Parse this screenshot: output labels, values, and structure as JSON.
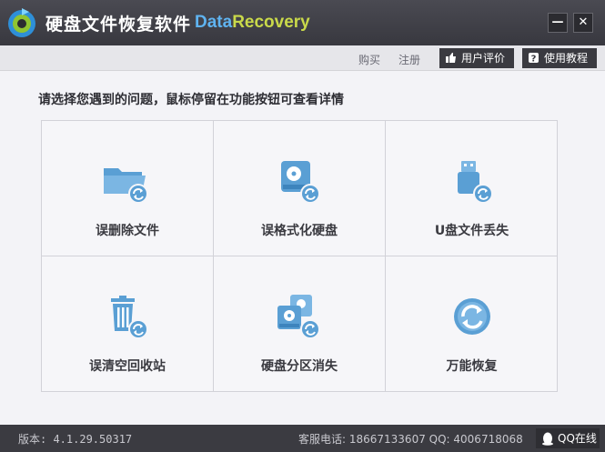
{
  "titlebar": {
    "app_title": "硬盘文件恢复软件",
    "brand_part1": "Data",
    "brand_part2": "Recovery",
    "minimize_icon": "minimize-icon",
    "close_icon": "close-icon"
  },
  "toolbar": {
    "buy_label": "购买",
    "register_label": "注册",
    "review_label": "用户评价",
    "tutorial_label": "使用教程"
  },
  "instruction": "请选择您遇到的问题，鼠标停留在功能按钮可查看详情",
  "tiles": [
    {
      "label": "误删除文件",
      "icon": "folder-recover-icon"
    },
    {
      "label": "误格式化硬盘",
      "icon": "harddisk-recover-icon"
    },
    {
      "label": "U盘文件丢失",
      "icon": "usb-recover-icon"
    },
    {
      "label": "误清空回收站",
      "icon": "recycle-bin-recover-icon"
    },
    {
      "label": "硬盘分区消失",
      "icon": "partition-recover-icon"
    },
    {
      "label": "万能恢复",
      "icon": "universal-recover-icon"
    }
  ],
  "statusbar": {
    "version": "版本: 4.1.29.50317",
    "contact": "客服电话: 18667133607 QQ: 4006718068",
    "qq_label": "QQ在线"
  },
  "colors": {
    "accent_blue": "#5a9fd4",
    "brand_blue": "#5fb3f0",
    "brand_green": "#c9d94a",
    "titlebar_bg": "#3f3f46"
  }
}
